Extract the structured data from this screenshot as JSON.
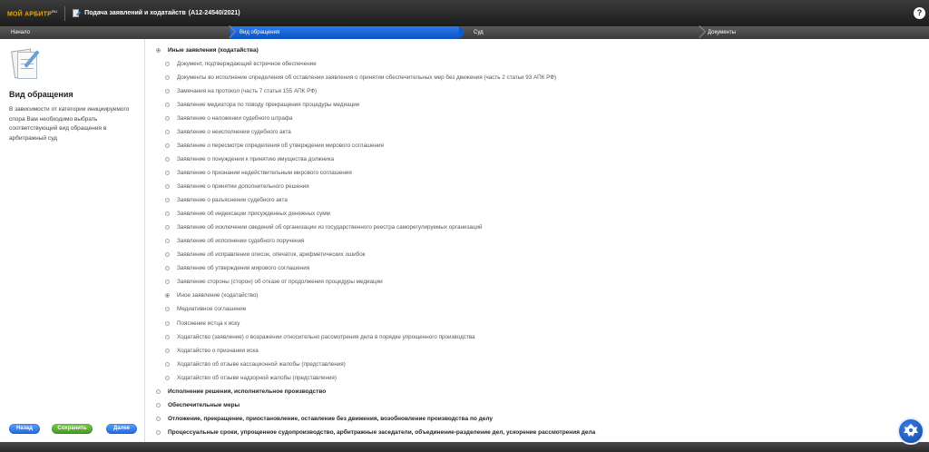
{
  "header": {
    "logo_main": "МОЙ АРБИТР",
    "logo_sup": "RU",
    "app_title": "Подача заявлений и ходатайств",
    "case_number": "(А12-24540/2021)",
    "help_label": "?"
  },
  "steps": [
    {
      "label": "Начало"
    },
    {
      "label": "Вид обращения"
    },
    {
      "label": "Суд"
    },
    {
      "label": "Документы"
    }
  ],
  "left": {
    "title": "Вид обращения",
    "description": "В зависимости от категории инициируемого спора Вам необходимо выбрать соответствующий вид обращения в арбитражный суд",
    "buttons": {
      "back": "Назад",
      "save": "Сохранить",
      "next": "Далее"
    }
  },
  "list": {
    "items": [
      {
        "label": "Иные заявления (ходатайства)",
        "level": 0,
        "selected": true
      },
      {
        "label": "Документ, подтверждающий встречное обеспечение",
        "level": 1,
        "selected": false
      },
      {
        "label": "Документы во исполнение определения об оставлении заявления о принятии обеспечительных мер без движения (часть 2 статьи 93 АПК РФ)",
        "level": 1,
        "selected": false
      },
      {
        "label": "Замечания на протокол (часть 7 статьи 155 АПК РФ)",
        "level": 1,
        "selected": false
      },
      {
        "label": "Заявление медиатора по поводу прекращения процедуры медиации",
        "level": 1,
        "selected": false
      },
      {
        "label": "Заявление о наложении судебного штрафа",
        "level": 1,
        "selected": false
      },
      {
        "label": "Заявление о неисполнении судебного акта",
        "level": 1,
        "selected": false
      },
      {
        "label": "Заявление о пересмотре определения об утверждении мирового соглашения",
        "level": 1,
        "selected": false
      },
      {
        "label": "Заявление о понуждении к принятию имущества должника",
        "level": 1,
        "selected": false
      },
      {
        "label": "Заявление о признании недействительным мирового соглашения",
        "level": 1,
        "selected": false
      },
      {
        "label": "Заявление о принятии дополнительного решения",
        "level": 1,
        "selected": false
      },
      {
        "label": "Заявление о разъяснении судебного акта",
        "level": 1,
        "selected": false
      },
      {
        "label": "Заявление об индексации присужденных денежных сумм",
        "level": 1,
        "selected": false
      },
      {
        "label": "Заявление об исключении сведений об организации из государственного реестра саморегулируемых организаций",
        "level": 1,
        "selected": false
      },
      {
        "label": "Заявление об исполнении судебного поручения",
        "level": 1,
        "selected": false
      },
      {
        "label": "Заявление об исправлении описок, опечаток, арифметических ошибок",
        "level": 1,
        "selected": false
      },
      {
        "label": "Заявление об утверждении мирового соглашения",
        "level": 1,
        "selected": false
      },
      {
        "label": "Заявление стороны (сторон) об отказе от продолжения процедуры медиации",
        "level": 1,
        "selected": false
      },
      {
        "label": "Иное заявление (ходатайство)",
        "level": 1,
        "selected": true
      },
      {
        "label": "Медиативное соглашение",
        "level": 1,
        "selected": false
      },
      {
        "label": "Пояснение истца к иску",
        "level": 1,
        "selected": false
      },
      {
        "label": "Ходатайство (заявление) о возражении относительно рассмотрения дела в порядке упрощенного производства",
        "level": 1,
        "selected": false
      },
      {
        "label": "Ходатайство о признании иска",
        "level": 1,
        "selected": false
      },
      {
        "label": "Ходатайство об отзыве кассационной жалобы (представления)",
        "level": 1,
        "selected": false
      },
      {
        "label": "Ходатайство об отзыве надзорной жалобы (представления)",
        "level": 1,
        "selected": false
      },
      {
        "label": "Исполнение решения, исполнительное производство",
        "level": 0,
        "selected": false
      },
      {
        "label": "Обеспечительные меры",
        "level": 0,
        "selected": false
      },
      {
        "label": "Отложение, прекращение, приостановление, оставление без движения, возобновление производства по делу",
        "level": 0,
        "selected": false
      },
      {
        "label": "Процессуальные сроки, упрощенное судопроизводство, арбитражные заседатели, объединение-разделение дел, ускорение рассмотрения дела",
        "level": 0,
        "selected": false
      }
    ]
  }
}
